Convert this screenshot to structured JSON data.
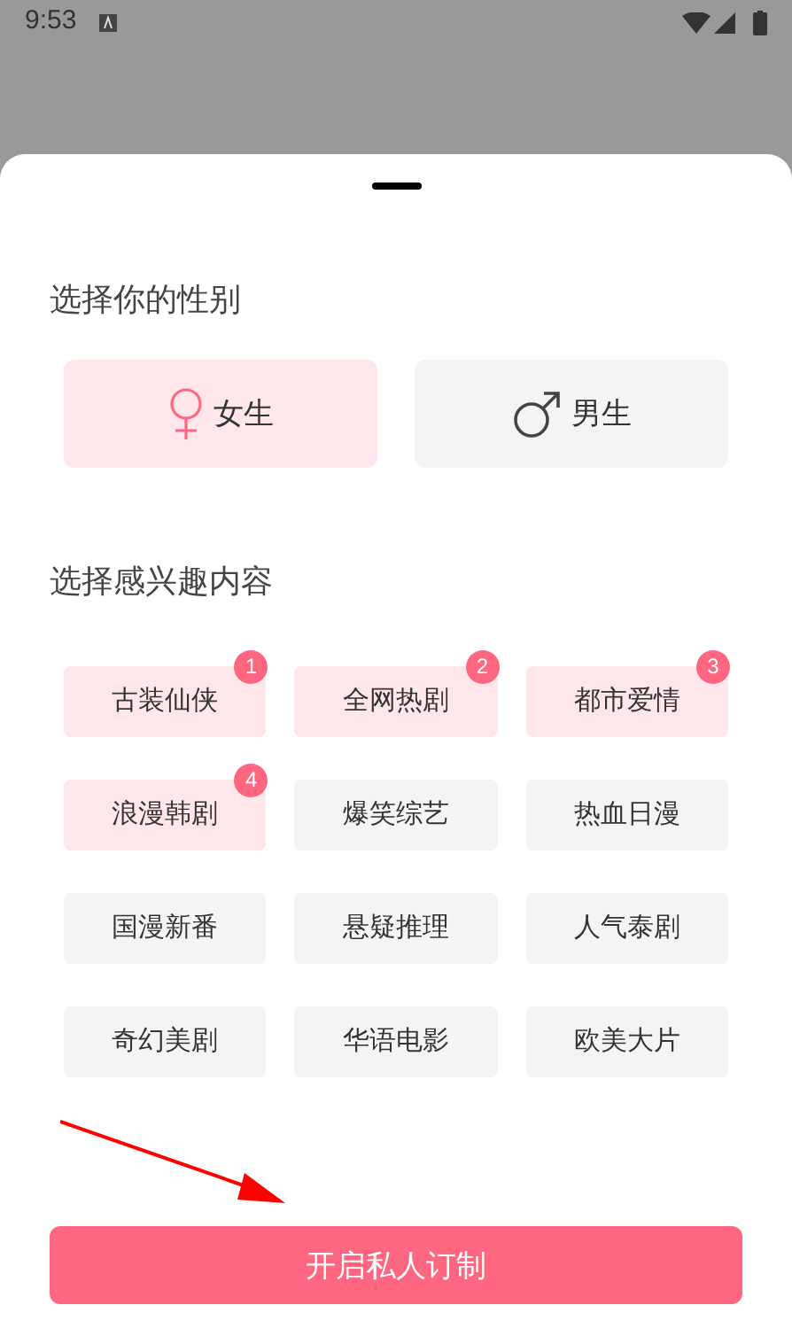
{
  "status_bar": {
    "time": "9:53"
  },
  "gender_section": {
    "title": "选择你的性别",
    "options": [
      {
        "label": "女生",
        "kind": "female",
        "selected": true
      },
      {
        "label": "男生",
        "kind": "male",
        "selected": false
      }
    ]
  },
  "interest_section": {
    "title": "选择感兴趣内容",
    "tags": [
      {
        "label": "古装仙侠",
        "selected": true,
        "badge": "1"
      },
      {
        "label": "全网热剧",
        "selected": true,
        "badge": "2"
      },
      {
        "label": "都市爱情",
        "selected": true,
        "badge": "3"
      },
      {
        "label": "浪漫韩剧",
        "selected": true,
        "badge": "4"
      },
      {
        "label": "爆笑综艺",
        "selected": false
      },
      {
        "label": "热血日漫",
        "selected": false
      },
      {
        "label": "国漫新番",
        "selected": false
      },
      {
        "label": "悬疑推理",
        "selected": false
      },
      {
        "label": "人气泰剧",
        "selected": false
      },
      {
        "label": "奇幻美剧",
        "selected": false
      },
      {
        "label": "华语电影",
        "selected": false
      },
      {
        "label": "欧美大片",
        "selected": false
      }
    ]
  },
  "submit_button": {
    "label": "开启私人订制"
  }
}
